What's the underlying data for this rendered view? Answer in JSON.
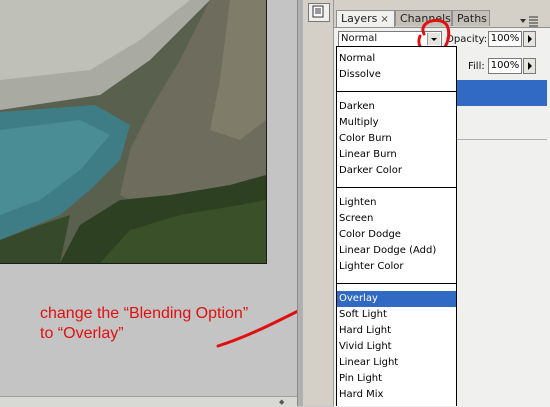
{
  "canvas": {
    "photo_description": "mountain-lake",
    "colors": {
      "lake": "#3f7d86",
      "slope": "#6e6e5e",
      "vegetation": "#2e4022"
    }
  },
  "instruction": {
    "line1": "change the “Blending Option”",
    "line2": "to “Overlay”",
    "color": "#e01010"
  },
  "layers_panel": {
    "tabs": [
      {
        "label": "Layers",
        "active": true,
        "close": "×"
      },
      {
        "label": "Channels",
        "active": false
      },
      {
        "label": "Paths",
        "active": false
      }
    ],
    "menu_icon": "panel-menu-icon",
    "blend_mode": {
      "value": "Normal"
    },
    "opacity": {
      "label": "Opacity:",
      "value": "100%"
    },
    "fill": {
      "label": "Fill:",
      "value": "100%"
    },
    "selected_color": "#316ac5"
  },
  "blend_dropdown": {
    "groups": [
      [
        "Normal",
        "Dissolve"
      ],
      [
        "Darken",
        "Multiply",
        "Color Burn",
        "Linear Burn",
        "Darker Color"
      ],
      [
        "Lighten",
        "Screen",
        "Color Dodge",
        "Linear Dodge (Add)",
        "Lighter Color"
      ],
      [
        "Overlay",
        "Soft Light",
        "Hard Light",
        "Vivid Light",
        "Linear Light",
        "Pin Light",
        "Hard Mix"
      ]
    ],
    "selected": "Overlay"
  }
}
